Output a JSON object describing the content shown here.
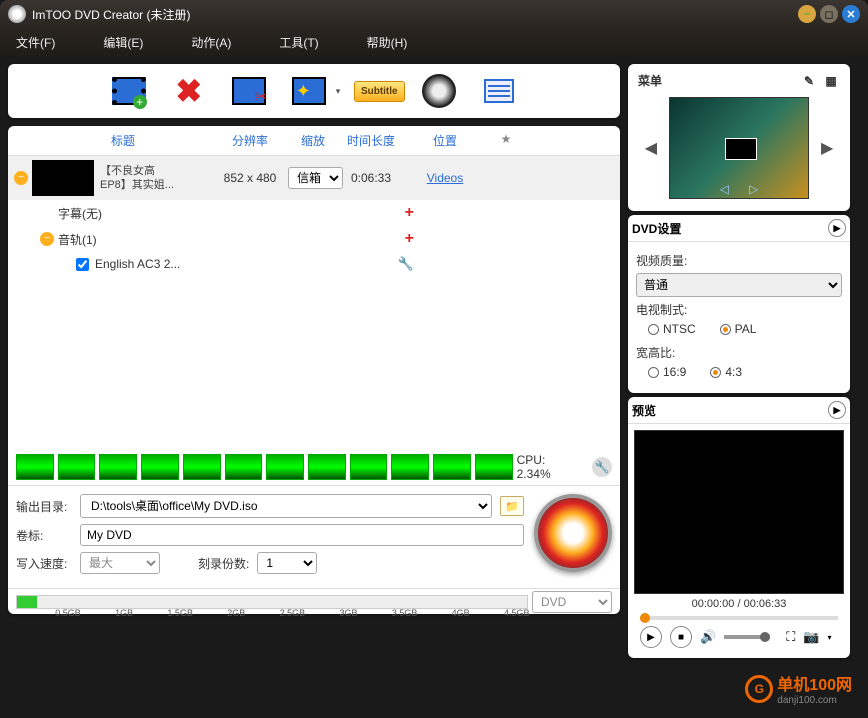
{
  "title": "ImTOO DVD Creator (未注册)",
  "menubar": {
    "file": "文件(F)",
    "edit": "编辑(E)",
    "action": "动作(A)",
    "tool": "工具(T)",
    "help": "帮助(H)"
  },
  "toolbar": {
    "subtitle": "Subtitle"
  },
  "columns": {
    "title": "标题",
    "resolution": "分辨率",
    "zoom": "缩放",
    "duration": "时间长度",
    "location": "位置",
    "star": "★"
  },
  "file": {
    "title1": "【不良女高",
    "title2": "EP8】其实姐...",
    "resolution": "852 x 480",
    "zoom": "信箱",
    "duration": "0:06:33",
    "location": "Videos",
    "subtitle_row": "字幕(无)",
    "audio_row": "音轨(1)",
    "audio_track": "English AC3 2..."
  },
  "cpu": {
    "label": "CPU:",
    "value": "2.34%"
  },
  "output": {
    "dest_label": "输出目录:",
    "dest_value": "D:\\tools\\桌面\\office\\My DVD.iso",
    "vol_label": "卷标:",
    "vol_value": "My DVD",
    "speed_label": "写入速度:",
    "speed_value": "最大",
    "copies_label": "刻录份数:",
    "copies_value": "1"
  },
  "sizebar": {
    "ticks": [
      "0.5GB",
      "1GB",
      "1.5GB",
      "2GB",
      "2.5GB",
      "3GB",
      "3.5GB",
      "4GB",
      "4.5GB"
    ],
    "disc": "DVD"
  },
  "right": {
    "menu_header": "菜单",
    "dvd_settings": "DVD设置",
    "video_quality_label": "视频质量:",
    "video_quality_value": "普通",
    "tv_standard_label": "电视制式:",
    "ntsc": "NTSC",
    "pal": "PAL",
    "aspect_label": "宽高比:",
    "a169": "16:9",
    "a43": "4:3",
    "preview": "预览",
    "time": "00:00:00 / 00:06:33"
  },
  "watermark": {
    "brand": "单机100网",
    "url": "danji100.com"
  }
}
